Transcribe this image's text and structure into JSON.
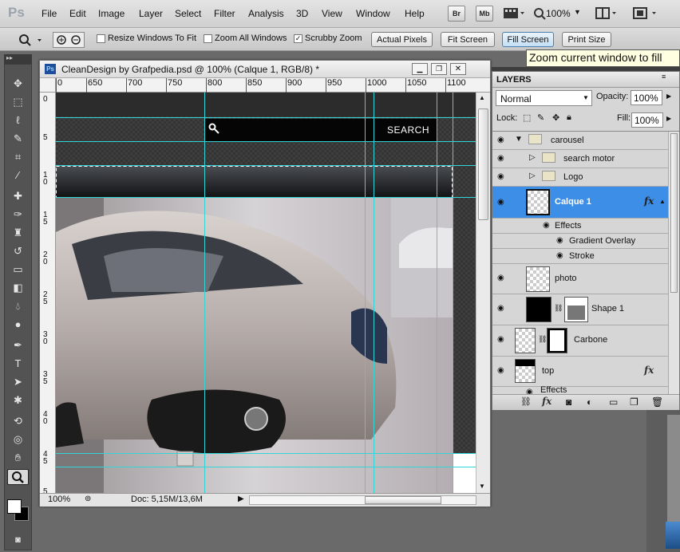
{
  "app": {
    "logo": "Ps",
    "menu": [
      "File",
      "Edit",
      "Image",
      "Layer",
      "Select",
      "Filter",
      "Analysis",
      "3D",
      "View",
      "Window",
      "Help"
    ],
    "mini_buttons": {
      "br": "Br",
      "mb": "Mb"
    },
    "zoom_level": "100%"
  },
  "options_bar": {
    "resize_windows_to_fit": {
      "label": "Resize Windows To Fit",
      "checked": false
    },
    "zoom_all_windows": {
      "label": "Zoom All Windows",
      "checked": false
    },
    "scrubby_zoom": {
      "label": "Scrubby Zoom",
      "checked": true
    },
    "actual_pixels": "Actual Pixels",
    "fit_screen": "Fit Screen",
    "fill_screen": "Fill Screen",
    "print_size": "Print Size",
    "tooltip": "Zoom current window to fill"
  },
  "document": {
    "title": "CleanDesign by Grafpedia.psd @ 100% (Calque 1, RGB/8) *",
    "ruler_top": [
      "0",
      "650",
      "700",
      "750",
      "800",
      "850",
      "900",
      "950",
      "1000",
      "1050",
      "1100"
    ],
    "ruler_left": [
      "0",
      "5",
      "1 0",
      "1 5",
      "2 0",
      "2 5",
      "3 0",
      "3 5",
      "4 0",
      "4 5",
      "5"
    ],
    "search_label": "SEARCH",
    "zoom": "100%",
    "doc_size": "Doc: 5,15M/13,6M"
  },
  "layers_panel": {
    "title": "LAYERS",
    "blend_mode": "Normal",
    "opacity_label": "Opacity:",
    "opacity": "100%",
    "lock_label": "Lock:",
    "fill_label": "Fill:",
    "fill": "100%",
    "rows": {
      "carousel": "carousel",
      "search_motor": "search motor",
      "logo": "Logo",
      "calque1": "Calque 1",
      "effects": "Effects",
      "gradient_overlay": "Gradient Overlay",
      "stroke": "Stroke",
      "photo": "photo",
      "shape1": "Shape 1",
      "carbone": "Carbone",
      "top": "top",
      "effects2": "Effects"
    },
    "fx": "fx"
  },
  "colors": {
    "selected_layer": "#3d8ee6",
    "guide": "#33d6d6",
    "accent": "#4a7fae"
  }
}
